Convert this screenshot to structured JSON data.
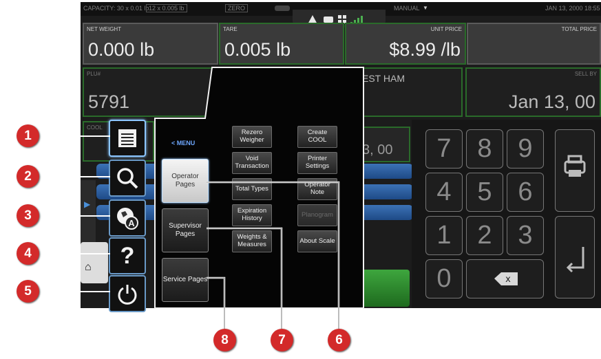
{
  "topbar": {
    "capacity": "CAPACITY: 30 x 0.01 lb",
    "capacity2": "12 x 0.005 lb",
    "zero": "ZERO",
    "mode": "MANUAL",
    "datetime": "JAN 13, 2000 18:55"
  },
  "fields": {
    "net_weight": {
      "label": "NET WEIGHT",
      "value": "0.000 lb"
    },
    "tare": {
      "label": "TARE",
      "value": "0.005 lb"
    },
    "unit_price": {
      "label": "UNIT PRICE",
      "value": "$8.99 /lb"
    },
    "total_price": {
      "label": "TOTAL PRICE",
      "value": ""
    },
    "plu": {
      "label": "PLU#",
      "value": "5791"
    },
    "product": {
      "value": "EST HAM"
    },
    "sell_by": {
      "label": "SELL BY",
      "value": "Jan 13, 00"
    },
    "cool": {
      "label": "COOL"
    },
    "peek_date": {
      "value": "3, 00"
    }
  },
  "keypad": {
    "keys": [
      "7",
      "8",
      "9",
      "4",
      "5",
      "6",
      "1",
      "2",
      "3",
      "0"
    ]
  },
  "menu": {
    "back": "< MENU",
    "pages": {
      "operator": "Operator Pages",
      "supervisor": "Supervisor Pages",
      "service": "Service Pages"
    },
    "options": {
      "rezero": "Rezero Weigher",
      "create_cool": "Create COOL",
      "void": "Void Transaction",
      "printer": "Printer Settings",
      "total_types": "Total Types",
      "operator_note": "Operator Note",
      "expiration": "Expiration History",
      "planogram": "Planogram",
      "weights": "Weights & Measures",
      "about": "About Scale"
    }
  },
  "callouts": [
    "1",
    "2",
    "3",
    "4",
    "5",
    "6",
    "7",
    "8"
  ]
}
